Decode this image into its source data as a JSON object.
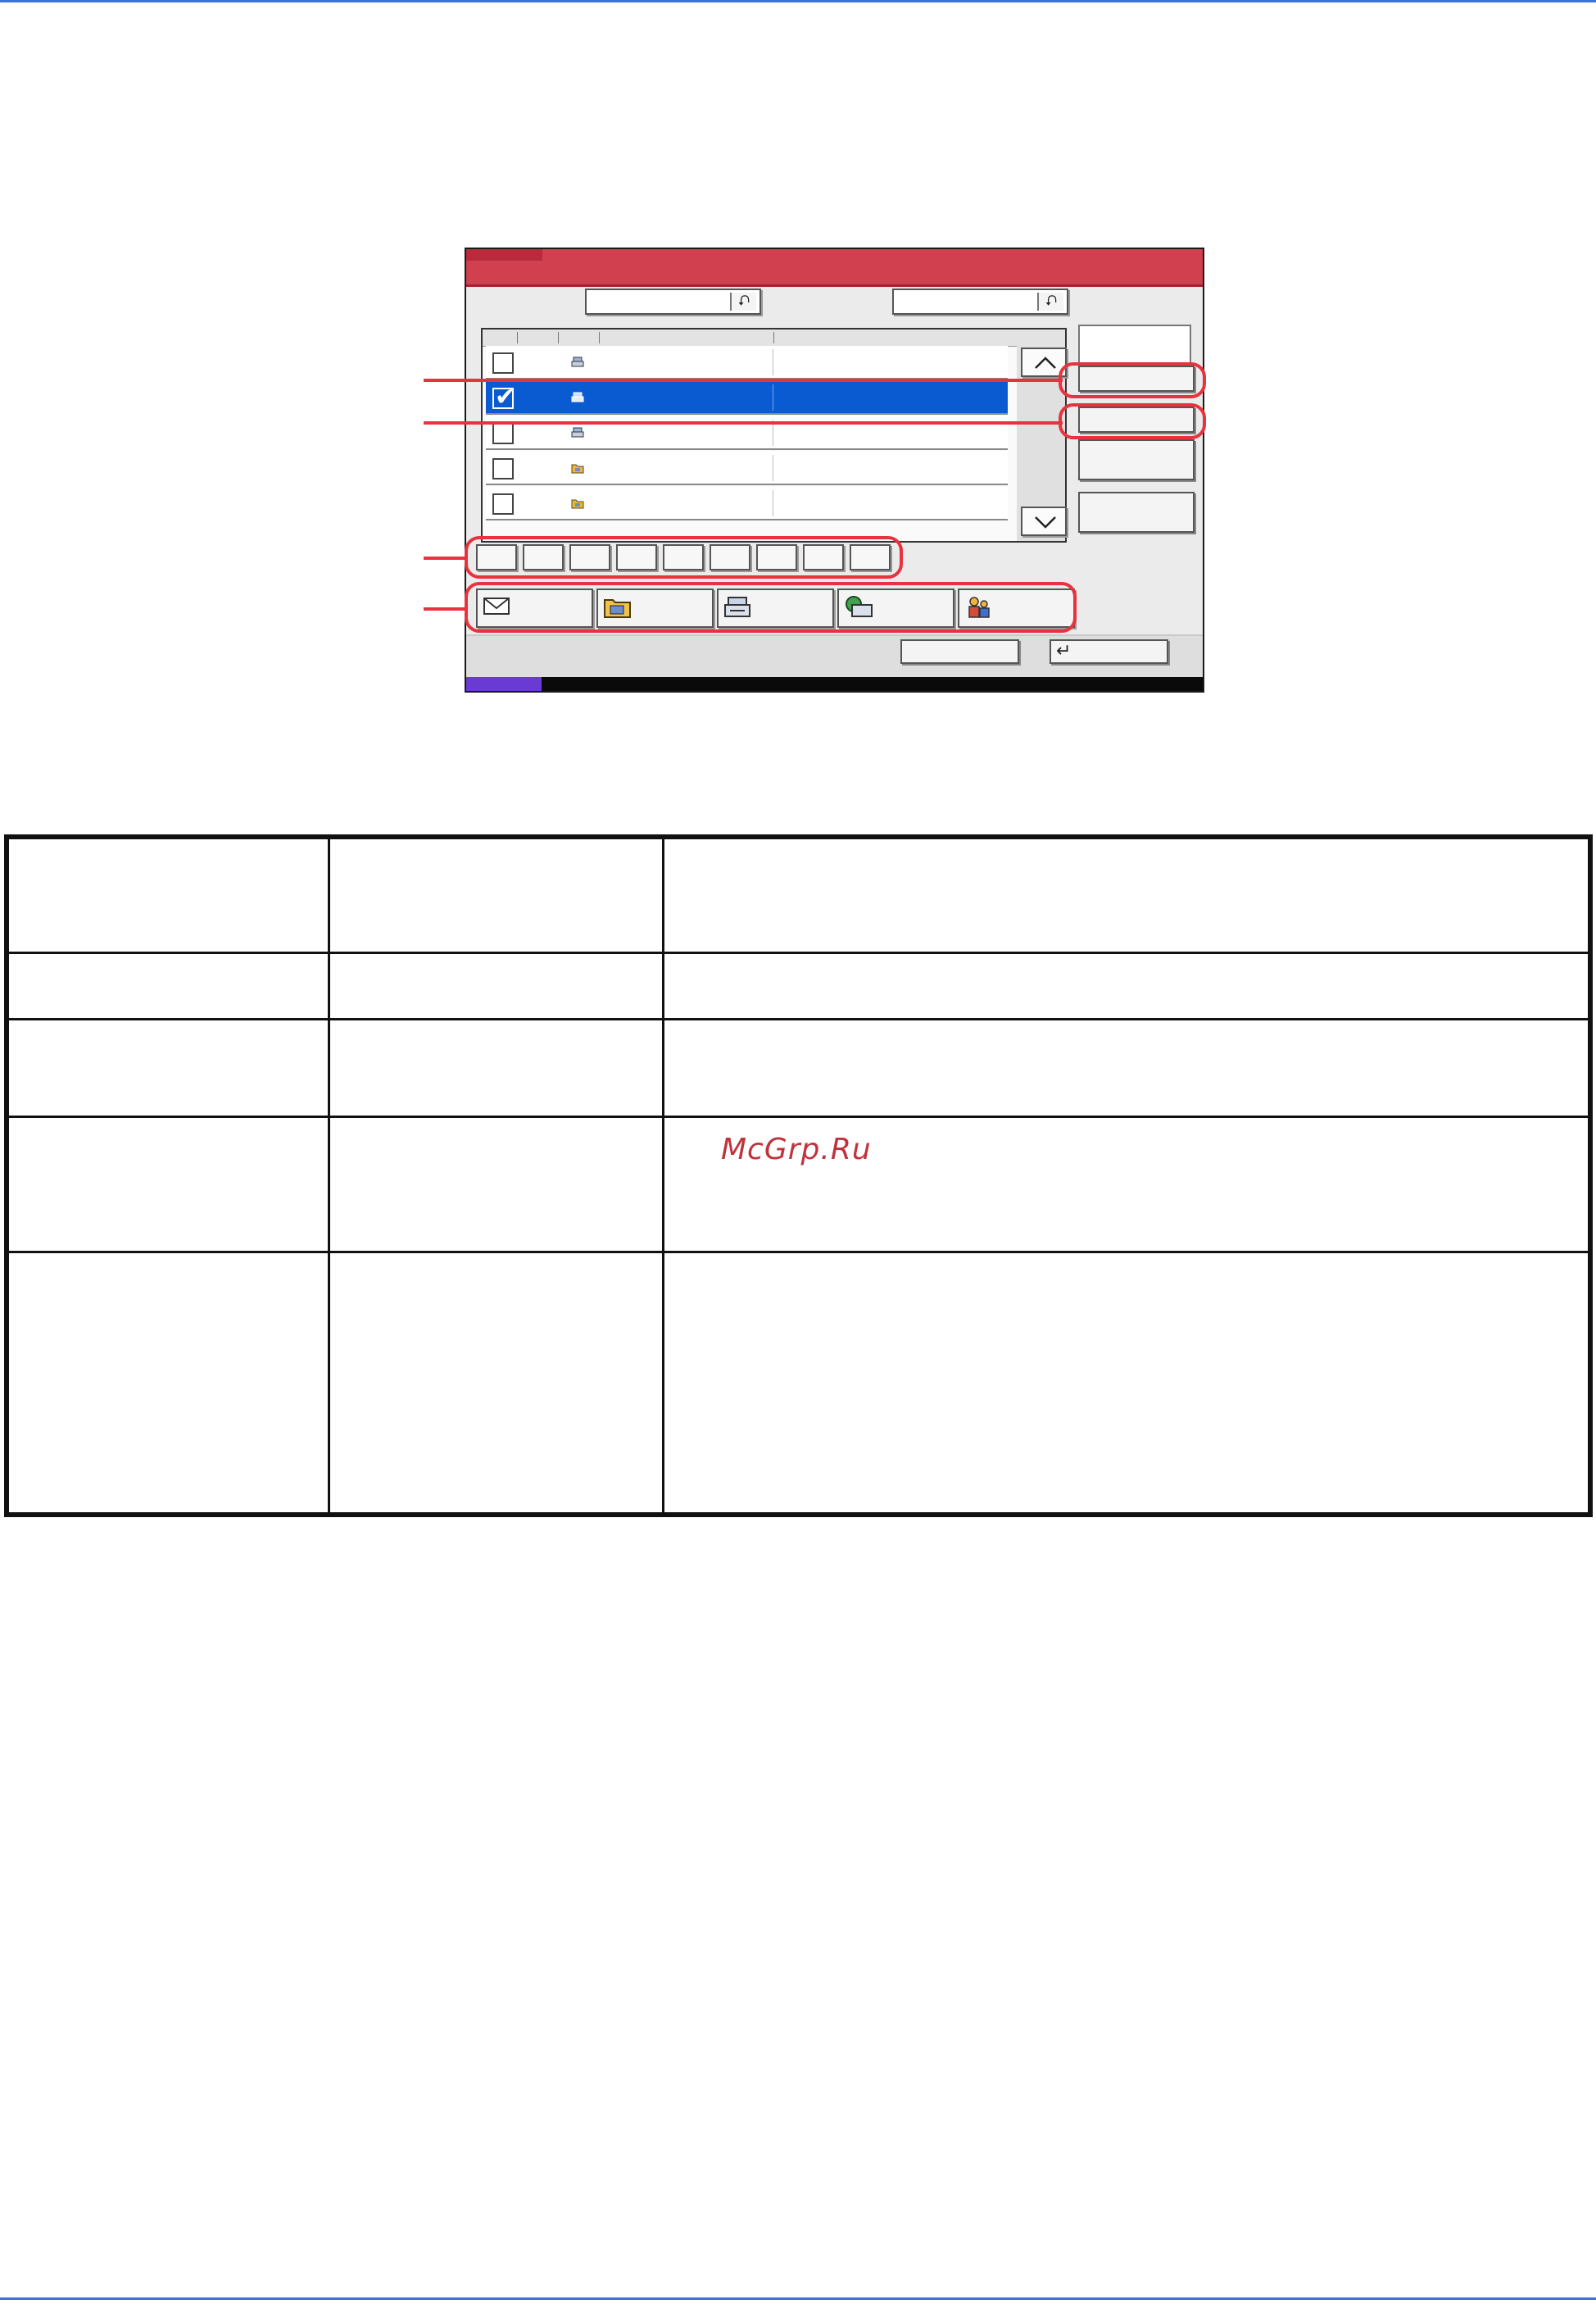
{
  "watermark": "McGrp.Ru",
  "panel": {
    "list_rows": [
      {
        "checked": false,
        "icon": "print-file-icon"
      },
      {
        "checked": true,
        "icon": "print-file-icon"
      },
      {
        "checked": false,
        "icon": "print-file-icon"
      },
      {
        "checked": false,
        "icon": "folder-file-icon"
      },
      {
        "checked": false,
        "icon": "folder-file-icon"
      }
    ],
    "page_button_count": 9,
    "destination_icons": [
      "email-icon",
      "folder-icon",
      "fax-icon",
      "network-fax-icon",
      "group-icon"
    ],
    "colors": {
      "title": "#d0404e",
      "selection": "#0a5bd2",
      "callout": "#e8323e",
      "status_accent": "#6a3bd4"
    }
  },
  "table": {
    "rows": 5,
    "columns": 3
  }
}
